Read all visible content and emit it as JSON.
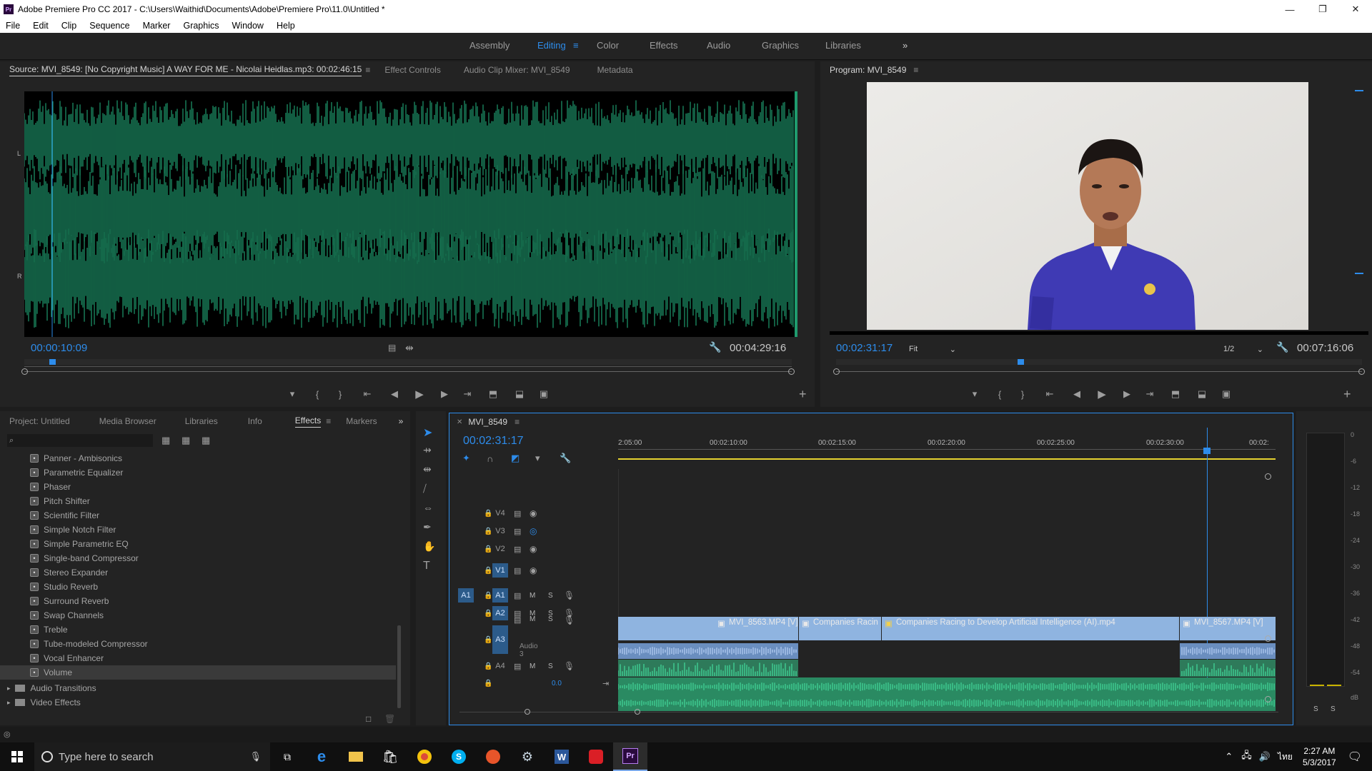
{
  "titlebar": {
    "app_icon": "Pr",
    "title": "Adobe Premiere Pro CC 2017 - C:\\Users\\Waithid\\Documents\\Adobe\\Premiere Pro\\11.0\\Untitled *"
  },
  "menu": [
    "File",
    "Edit",
    "Clip",
    "Sequence",
    "Marker",
    "Graphics",
    "Window",
    "Help"
  ],
  "workspaces": {
    "items": [
      "Assembly",
      "Editing",
      "Color",
      "Effects",
      "Audio",
      "Graphics",
      "Libraries"
    ],
    "active": "Editing"
  },
  "source": {
    "tab_source": "Source: MVI_8549: [No Copyright Music] A WAY FOR ME - Nicolai Heidlas.mp3: 00:02:46:15",
    "tab_effect_controls": "Effect Controls",
    "tab_audio_mixer": "Audio Clip Mixer: MVI_8549",
    "tab_metadata": "Metadata",
    "timecode": "00:00:10:09",
    "duration": "00:04:29:16",
    "channel_left": "L",
    "channel_right": "R",
    "waveform_color": "#1f9b6e",
    "playhead_color": "#2d8ceb",
    "playhead_fraction": 0.036
  },
  "program": {
    "title": "Program: MVI_8549",
    "timecode": "00:02:31:17",
    "fit": "Fit",
    "resolution": "1/2",
    "duration": "00:07:16:06",
    "playhead_fraction": 0.35
  },
  "project": {
    "tabs": [
      "Project: Untitled",
      "Media Browser",
      "Libraries",
      "Info",
      "Effects",
      "Markers"
    ],
    "active_tab": "Effects",
    "search_placeholder": "",
    "effects": [
      "Panner - Ambisonics",
      "Parametric Equalizer",
      "Phaser",
      "Pitch Shifter",
      "Scientific Filter",
      "Simple Notch Filter",
      "Simple Parametric EQ",
      "Single-band Compressor",
      "Stereo Expander",
      "Studio Reverb",
      "Surround Reverb",
      "Swap Channels",
      "Treble",
      "Tube-modeled Compressor",
      "Vocal Enhancer",
      "Volume"
    ],
    "selected_effect": "Volume",
    "folders": [
      "Audio Transitions",
      "Video Effects"
    ]
  },
  "timeline": {
    "tab": "MVI_8549",
    "timecode": "00:02:31:17",
    "ruler": [
      "2:05:00",
      "00:02:10:00",
      "00:02:15:00",
      "00:02:20:00",
      "00:02:25:00",
      "00:02:30:00",
      "00:02:"
    ],
    "video_tracks": [
      "V4",
      "V3",
      "V2",
      "V1"
    ],
    "audio_tracks": [
      "A1",
      "A2",
      "A3",
      "A4"
    ],
    "source_patch": "A1",
    "a3_name": "Audio 3",
    "master_value": "0.0",
    "mute_label": "M",
    "solo_label": "S",
    "clips_v1": [
      "MVI_8563.MP4 [V]",
      "Companies Racin",
      "Companies Racing to Develop Artificial Intelligence (AI).mp4",
      "MVI_8567.MP4 [V]"
    ],
    "clip_color": "#8fb4e0",
    "audio_color": "#1f9b6e"
  },
  "meter": {
    "scale": [
      "0",
      "-6",
      "-12",
      "-18",
      "-24",
      "-30",
      "-36",
      "-42",
      "-48",
      "-54",
      "dB"
    ],
    "solo": [
      "S",
      "S"
    ]
  },
  "taskbar": {
    "search_placeholder": "Type here to search",
    "time": "2:27 AM",
    "date": "5/3/2017",
    "lang": "ไทย"
  }
}
